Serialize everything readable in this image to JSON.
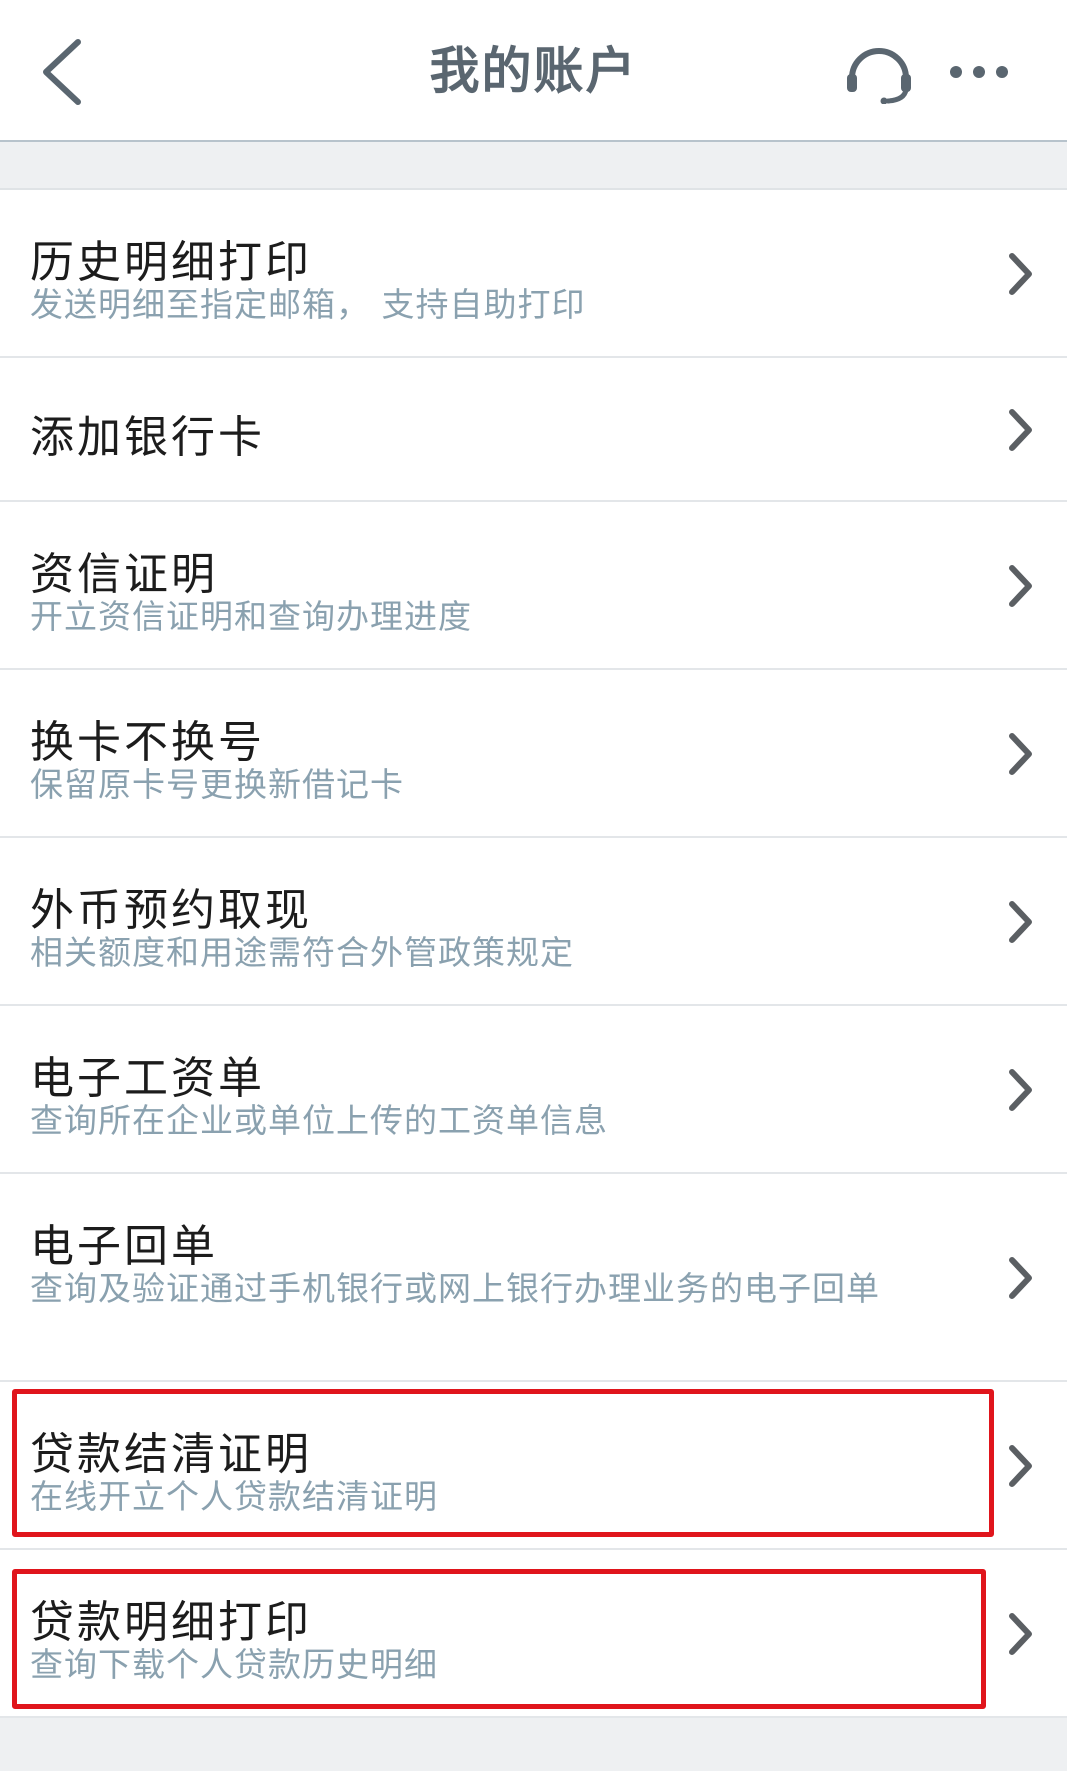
{
  "header": {
    "title": "我的账户"
  },
  "icons": {
    "back": "chevron-left-icon",
    "headset": "headset-icon",
    "more": "more-horizontal-icon",
    "row": "chevron-right-icon"
  },
  "colors": {
    "highlight": "#e0151c",
    "subtitle": "#8aa1af",
    "title": "#5a6670"
  },
  "items": [
    {
      "title": "历史明细打印",
      "subtitle": "发送明细至指定邮箱， 支持自助打印"
    },
    {
      "title": "添加银行卡",
      "subtitle": ""
    },
    {
      "title": "资信证明",
      "subtitle": "开立资信证明和查询办理进度"
    },
    {
      "title": "换卡不换号",
      "subtitle": "保留原卡号更换新借记卡"
    },
    {
      "title": "外币预约取现",
      "subtitle": "相关额度和用途需符合外管政策规定"
    },
    {
      "title": "电子工资单",
      "subtitle": "查询所在企业或单位上传的工资单信息"
    },
    {
      "title": "电子回单",
      "subtitle": "查询及验证通过手机银行或网上银行办理业务的电子回单"
    },
    {
      "title": "贷款结清证明",
      "subtitle": "在线开立个人贷款结清证明"
    },
    {
      "title": "贷款明细打印",
      "subtitle": "查询下载个人贷款历史明细"
    }
  ]
}
